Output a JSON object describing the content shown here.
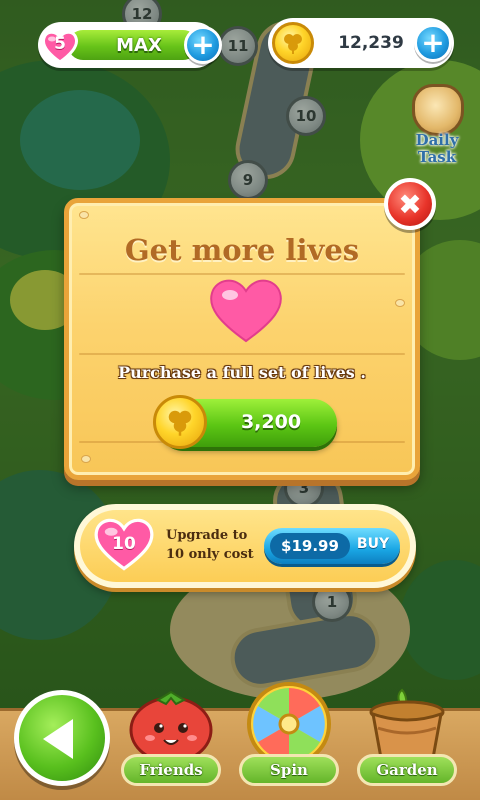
{
  "top_bar": {
    "lives_count": "5",
    "lives_label": "MAX",
    "coins_value": "12,239",
    "plus_label": "+",
    "daily_task_line1": "Daily",
    "daily_task_line2": "Task"
  },
  "map": {
    "levels": [
      "12",
      "11",
      "10",
      "9",
      "3",
      "1"
    ]
  },
  "dialog": {
    "title": "Get more lives",
    "description": "Purchase a full set of lives .",
    "price": "3,200",
    "close_symbol": "✖"
  },
  "upgrade": {
    "lives_target": "10",
    "text_line1": "Upgrade to",
    "text_line2": "10 only cost",
    "price": "$19.99",
    "buy_label": "BUY"
  },
  "bottom_nav": {
    "items": [
      {
        "label": "Friends"
      },
      {
        "label": "Spin"
      },
      {
        "label": "Garden"
      }
    ]
  },
  "colors": {
    "accent_green": "#5cc614",
    "accent_blue": "#1aa6e4",
    "heart_pink": "#ff5aa5",
    "close_red": "#e8342a",
    "panel_gold": "#fcd36e"
  }
}
